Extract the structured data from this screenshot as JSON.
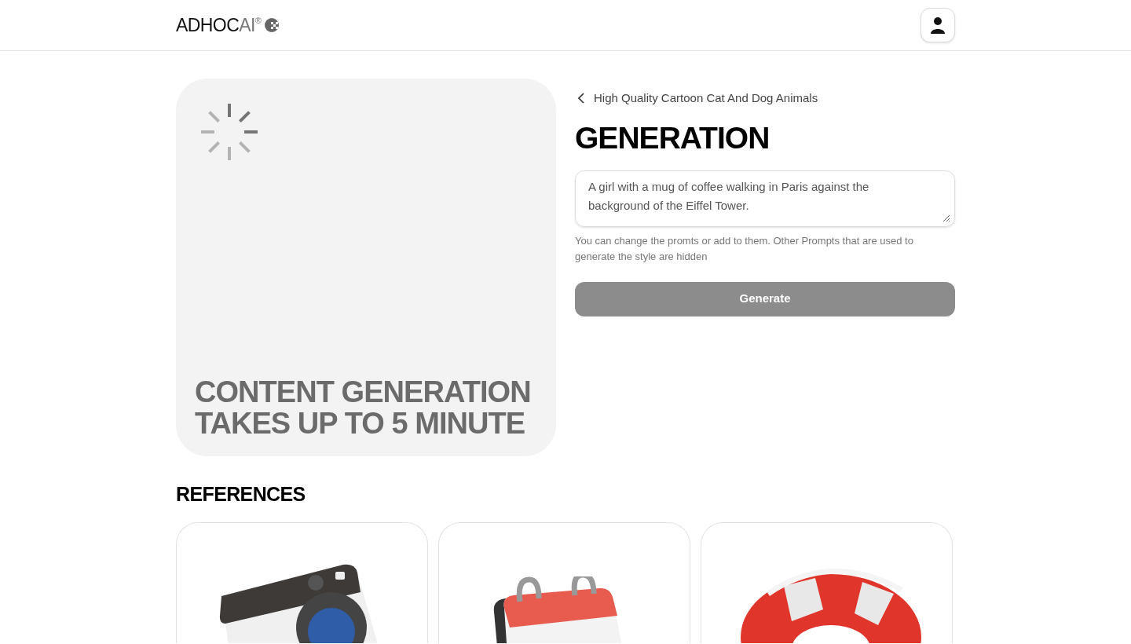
{
  "header": {
    "logo": {
      "main": "ADHOC",
      "accent": "AI",
      "mark": "®"
    }
  },
  "preview": {
    "loading": true,
    "caption": "CONTENT GENERATION TAKES UP TO 5 MINUTE"
  },
  "generation": {
    "back_link": "High Quality Cartoon Cat And Dog Animals",
    "title": "GENERATION",
    "prompt": {
      "value": "A girl with a mug of coffee walking in Paris against the background of the Eiffel Tower."
    },
    "hint": "You can change the promts or add to them. Other Prompts that are used to generate the style are hidden",
    "button": {
      "label": "Generate",
      "disabled": true
    }
  },
  "references": {
    "title": "REFERENCES",
    "items": [
      {
        "kind": "washing-machine"
      },
      {
        "kind": "calendar"
      },
      {
        "kind": "lifebuoy"
      }
    ]
  }
}
